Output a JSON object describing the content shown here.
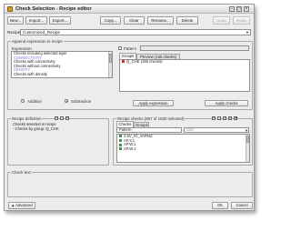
{
  "window": {
    "title": "Check Selection - Recipe editor",
    "controls": {
      "minimize": "–",
      "maximize": "□",
      "close": "×"
    }
  },
  "toolbar": {
    "new": "New...",
    "import": "Import...",
    "export": "Export...",
    "copy": "Copy...",
    "clear": "Clear",
    "rename": "Rename...",
    "delete": "Delete",
    "undo": "Undo",
    "redo": "Redo"
  },
  "recipe": {
    "label": "Recipe",
    "value": "Customized_Recipe"
  },
  "append": {
    "group_label": "Append expression to recipe",
    "expression_label": "Expression",
    "items": [
      {
        "text": "Checks including selected layer",
        "kind": "item"
      },
      {
        "text": "CONNECTIVITY",
        "kind": "category"
      },
      {
        "text": "Checks with connectivity",
        "kind": "item"
      },
      {
        "text": "Checks without connectivity",
        "kind": "item"
      },
      {
        "text": "DENSITY",
        "kind": "category"
      },
      {
        "text": "Checks with density",
        "kind": "item"
      }
    ],
    "addition_label": "Addition",
    "subtraction_label": "Subtraction",
    "pattern_label": "Pattern",
    "tabs": [
      "Groups",
      "Preview (155 checks)"
    ],
    "groups_items": [
      {
        "text": "Q_CHK (155 checks)",
        "color": "#c43a2a"
      }
    ],
    "apply_expression": "Apply expression",
    "apply_checks": "Apply checks"
  },
  "recipe_definition": {
    "label": "Recipe definition",
    "items": [
      "Checks selected in recipe",
      "- Checks by group: Q_CHK"
    ]
  },
  "recipe_checks": {
    "label": "Recipe checks (857 of 1630 selected)",
    "tabs": [
      "Checks",
      "Groups"
    ],
    "pattern_placeholder": "Pattern",
    "sort_placeholder": "Sort",
    "items": [
      {
        "text": "3.9V_IO_VARNZ",
        "color": "#2f9e3a"
      },
      {
        "text": "AP.3.1",
        "color": "#2f9e3a"
      },
      {
        "text": "AP.W.1",
        "color": "#2f9e3a"
      },
      {
        "text": "AP.W.1",
        "color": "#2f9e3a"
      }
    ]
  },
  "check_text": {
    "label": "Check text"
  },
  "footer": {
    "advanced": "Advanced",
    "ok": "OK",
    "cancel": "Cancel"
  },
  "colors": {
    "selection": "#3875d7",
    "category_text": "#7a7ad0",
    "window_bg": "#ececec"
  }
}
